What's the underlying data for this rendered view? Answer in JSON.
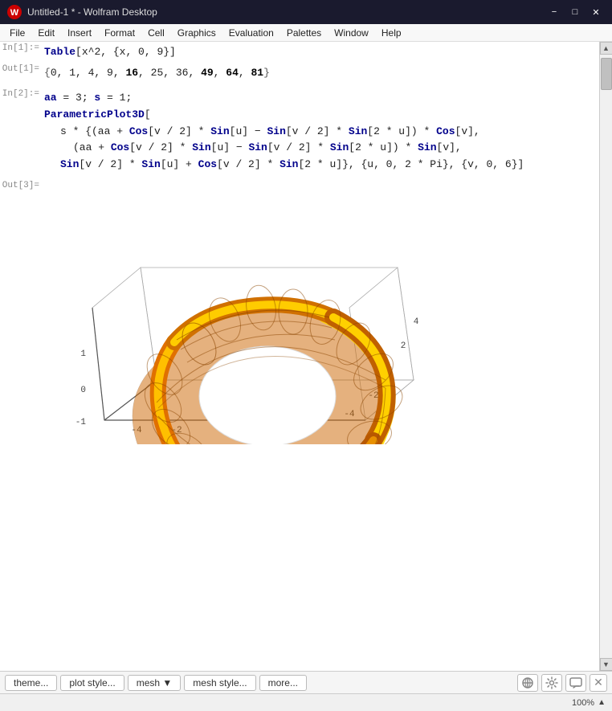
{
  "titleBar": {
    "title": "Untitled-1 * - Wolfram Desktop",
    "icon": "wolfram-icon",
    "minimizeLabel": "−",
    "maximizeLabel": "□",
    "closeLabel": "✕"
  },
  "menuBar": {
    "items": [
      "File",
      "Edit",
      "Insert",
      "Format",
      "Cell",
      "Graphics",
      "Evaluation",
      "Palettes",
      "Window",
      "Help"
    ]
  },
  "cells": [
    {
      "label": "In[1]:=",
      "type": "input",
      "content": "Table[x^2, {x, 0, 9}]"
    },
    {
      "label": "Out[1]=",
      "type": "output",
      "content": "{0, 1, 4, 9, 16, 25, 36, 49, 64, 81}"
    },
    {
      "label": "In[2]:=",
      "type": "input",
      "lines": [
        "aa = 3; s = 1;",
        "ParametricPlot3D[",
        "  s * {(aa + Cos[v/2] * Sin[u] - Sin[v/2] * Sin[2*u]) * Cos[v],",
        "    (aa + Cos[v/2] * Sin[u] - Sin[v/2] * Sin[2*u]) * Sin[v],",
        "  Sin[v/2] * Sin[u] + Cos[v/2] * Sin[2*u]}, {u, 0, 2*Pi}, {v, 0, 6}]"
      ]
    },
    {
      "label": "Out[3]=",
      "type": "plot"
    }
  ],
  "toolbar": {
    "buttons": [
      "theme...",
      "plot style...",
      "mesh ▼",
      "mesh style...",
      "more..."
    ],
    "icons": [
      "link-icon",
      "gear-icon",
      "comment-icon"
    ]
  },
  "statusBar": {
    "zoom": "100%"
  }
}
